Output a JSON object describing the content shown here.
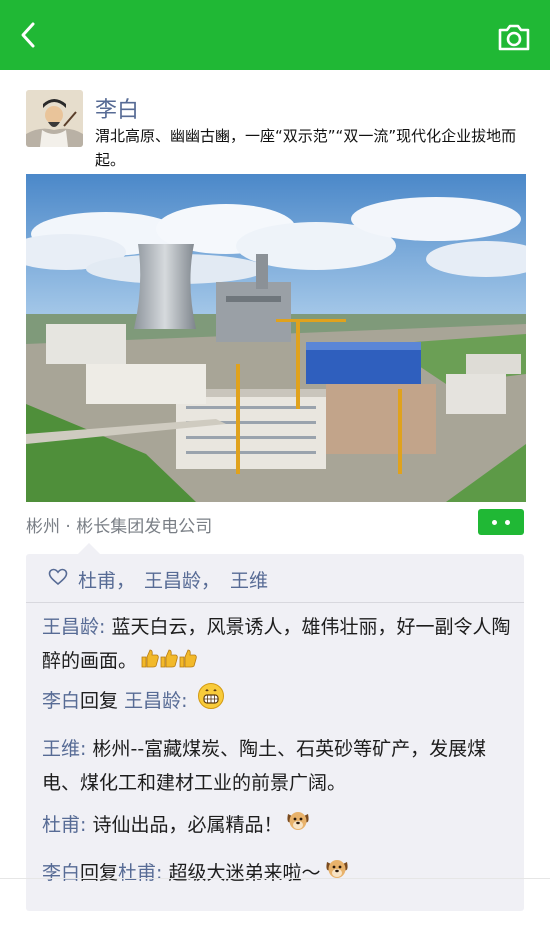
{
  "post": {
    "author": "李白",
    "text": "渭北高原、幽幽古豳，一座“双示范”“双一流”现代化企业拔地而起。",
    "location": "彬州 · 彬长集团发电公司"
  },
  "likes": [
    "杜甫",
    "王昌龄",
    "王维"
  ],
  "likes_separator": "，",
  "comments": [
    {
      "author": "王昌龄",
      "colon": ":",
      "text": " 蓝天白云，风景诱人，雄伟壮丽，好一副令人陶醉的画面。",
      "emoji": "thumbs-up-icon"
    },
    {
      "author": "李白",
      "reply_word": "回复",
      "reply_to": "王昌龄",
      "colon": ":",
      "emoji": "grin-icon"
    },
    {
      "author": "王维",
      "colon": ":",
      "text": " 彬州--富藏煤炭、陶土、石英砂等矿产，发展煤电、煤化工和建材工业的前景广阔。"
    },
    {
      "author": "杜甫",
      "colon": ":",
      "text": " 诗仙出品，必属精品！",
      "emoji": "dog-icon"
    },
    {
      "author": "李白",
      "reply_word": "回复",
      "reply_to": "杜甫",
      "colon": ":",
      "text": " 超级大迷弟来啦～",
      "emoji": "dog-icon"
    }
  ],
  "colors": {
    "brand": "#20b835",
    "name_link": "#576b95",
    "panel_bg": "#f0f0f5"
  }
}
